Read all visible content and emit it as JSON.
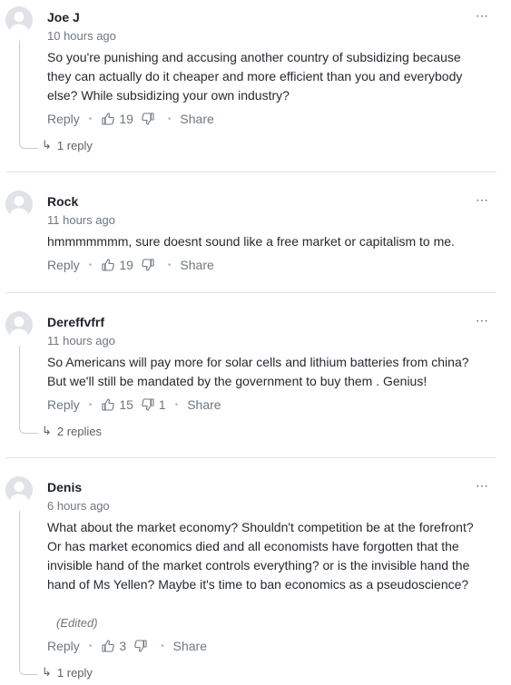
{
  "comments": [
    {
      "author": "Joe J",
      "time": "10 hours ago",
      "text": "So you're punishing and accusing  another country of subsidizing because they can actually do it cheaper and more efficient than you and everybody else? While subsidizing your own industry?",
      "reply_label": "Reply",
      "likes": "19",
      "dislikes": "",
      "share_label": "Share",
      "replies_label": "1 reply"
    },
    {
      "author": "Rock",
      "time": "11 hours ago",
      "text": "hmmmmmmm, sure doesnt sound like a free market or capitalism to me.",
      "reply_label": "Reply",
      "likes": "19",
      "dislikes": "",
      "share_label": "Share"
    },
    {
      "author": "Dereffvfrf",
      "time": "11 hours ago",
      "text": "So Americans will pay more for solar cells and lithium batteries from china? But we'll still be mandated by the government to buy them . Genius!",
      "reply_label": "Reply",
      "likes": "15",
      "dislikes": "1",
      "share_label": "Share",
      "replies_label": "2 replies"
    },
    {
      "author": "Denis",
      "time": "6 hours ago",
      "text": "What about the market economy? Shouldn't competition be at the forefront? Or has market economics died and all economists have forgotten that the invisible hand of the market controls everything? or is the invisible hand the hand of Ms Yellen? Maybe it's time to ban economics as a pseudoscience?",
      "edited_label": "(Edited)",
      "reply_label": "Reply",
      "likes": "3",
      "dislikes": "",
      "share_label": "Share",
      "replies_label": "1 reply"
    }
  ],
  "more_icon": "ellipsis-icon",
  "thumbs_up_icon": "thumbs-up-icon",
  "thumbs_down_icon": "thumbs-down-icon",
  "reply_arrow_icon": "reply-arrow-icon"
}
